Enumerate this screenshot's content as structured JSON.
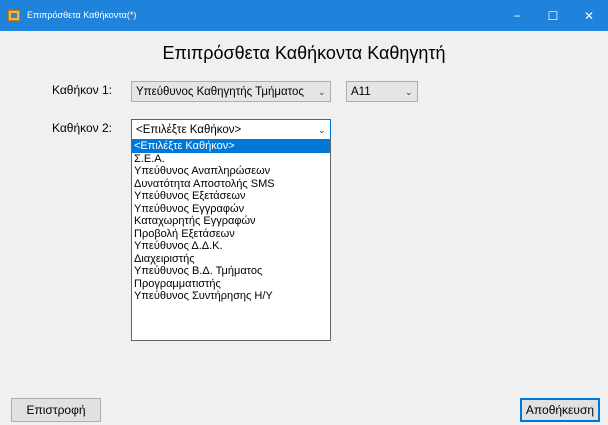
{
  "window": {
    "title": "Επιπρόσθετα Καθήκοντα(*)",
    "controls": {
      "minimize": "−",
      "maximize": "☐",
      "close": "✕"
    }
  },
  "form": {
    "heading": "Επιπρόσθετα Καθήκοντα Καθηγητή",
    "duty1": {
      "label": "Καθήκον 1:",
      "value": "Υπεύθυνος Καθηγητής Τμήματος",
      "room_value": "Α11"
    },
    "duty2": {
      "label": "Καθήκον 2:",
      "value": "<Επιλέξτε Καθήκον>",
      "options": [
        "<Επιλέξτε Καθήκον>",
        "Σ.Ε.Α.",
        "Υπεύθυνος Αναπληρώσεων",
        "Δυνατότητα Αποστολής SMS",
        "Υπεύθυνος Εξετάσεων",
        "Υπεύθυνος Εγγραφών",
        "Καταχωρητής Εγγραφών",
        "Προβολή Εξετάσεων",
        "Υπεύθυνος Δ.Δ.Κ.",
        "Διαχειριστής",
        "Υπεύθυνος Β.Δ. Τμήματος",
        "Προγραμματιστής",
        "Υπεύθυνος Συντήρησης Η/Υ"
      ],
      "highlighted_index": 0
    }
  },
  "buttons": {
    "back": "Επιστροφή",
    "save": "Αποθήκευση"
  },
  "icons": {
    "app": "app-window-icon",
    "dropdown": "chevron-down-icon"
  },
  "colors": {
    "titlebar": "#1f83db",
    "selection": "#0078d7",
    "client_background": "#f0f0f0"
  }
}
